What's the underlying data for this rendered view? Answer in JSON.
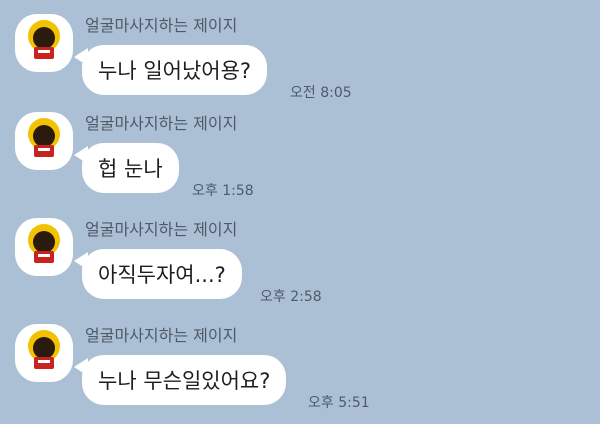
{
  "messages": [
    {
      "sender": "얼굴마사지하는 제이지",
      "text": "누나 일어났어용?",
      "time": "오전 8:05",
      "avatar_icon": "profile-photo-icon"
    },
    {
      "sender": "얼굴마사지하는 제이지",
      "text": "헙 눈나",
      "time": "오후 1:58",
      "avatar_icon": "profile-photo-icon"
    },
    {
      "sender": "얼굴마사지하는 제이지",
      "text": "아직두자여...?",
      "time": "오후 2:58",
      "avatar_icon": "profile-photo-icon"
    },
    {
      "sender": "얼굴마사지하는 제이지",
      "text": "누나 무슨일있어요?",
      "time": "오후 5:51",
      "avatar_icon": "profile-photo-icon"
    }
  ],
  "colors": {
    "background": "#acc0d5",
    "bubble": "#ffffff",
    "meta_text": "#4f5a66"
  }
}
